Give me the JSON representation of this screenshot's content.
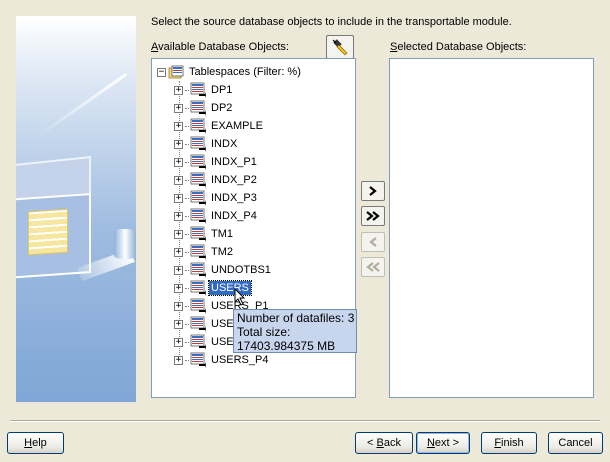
{
  "instruction": "Select the source database objects to include in the transportable module.",
  "available": {
    "prefix": "A",
    "rest": "vailable Database Objects:"
  },
  "selected": {
    "prefix": "S",
    "rest": "elected Database Objects:"
  },
  "tree": {
    "root_label": "Tablespaces  (Filter: %)",
    "items": [
      {
        "label": "DP1"
      },
      {
        "label": "DP2"
      },
      {
        "label": "EXAMPLE"
      },
      {
        "label": "INDX"
      },
      {
        "label": "INDX_P1"
      },
      {
        "label": "INDX_P2"
      },
      {
        "label": "INDX_P3"
      },
      {
        "label": "INDX_P4"
      },
      {
        "label": "TM1"
      },
      {
        "label": "TM2"
      },
      {
        "label": "UNDOTBS1"
      },
      {
        "label": "USERS"
      },
      {
        "label": "USERS_P1"
      },
      {
        "label": "USER"
      },
      {
        "label": "USER"
      },
      {
        "label": "USERS_P4"
      }
    ],
    "selected_item": "USERS",
    "expand_symbol": "+",
    "collapse_symbol": "−"
  },
  "tooltip": {
    "line1": "Number of datafiles: 3",
    "line2": "Total size:",
    "line3": "17403.984375 MB"
  },
  "move_buttons": {
    "move_one": "›",
    "move_all": "»",
    "remove_one": "‹",
    "remove_all": "«"
  },
  "footer": {
    "help": {
      "prefix": "H",
      "rest": "elp"
    },
    "back": {
      "arrow": "< ",
      "prefix": "B",
      "rest": "ack"
    },
    "next": {
      "prefix": "N",
      "rest": "ext >"
    },
    "finish": {
      "prefix": "F",
      "rest": "inish"
    },
    "cancel": "Cancel"
  },
  "colors": {
    "selection": "#316ac5",
    "tooltip_bg": "#c7d6ed",
    "panel_border": "#7f9db9",
    "background": "#ece9d8"
  },
  "icons": {
    "filter": "flashlight-icon",
    "tablespace": "tablespace-icon",
    "root": "tablespaces-folder-icon"
  }
}
